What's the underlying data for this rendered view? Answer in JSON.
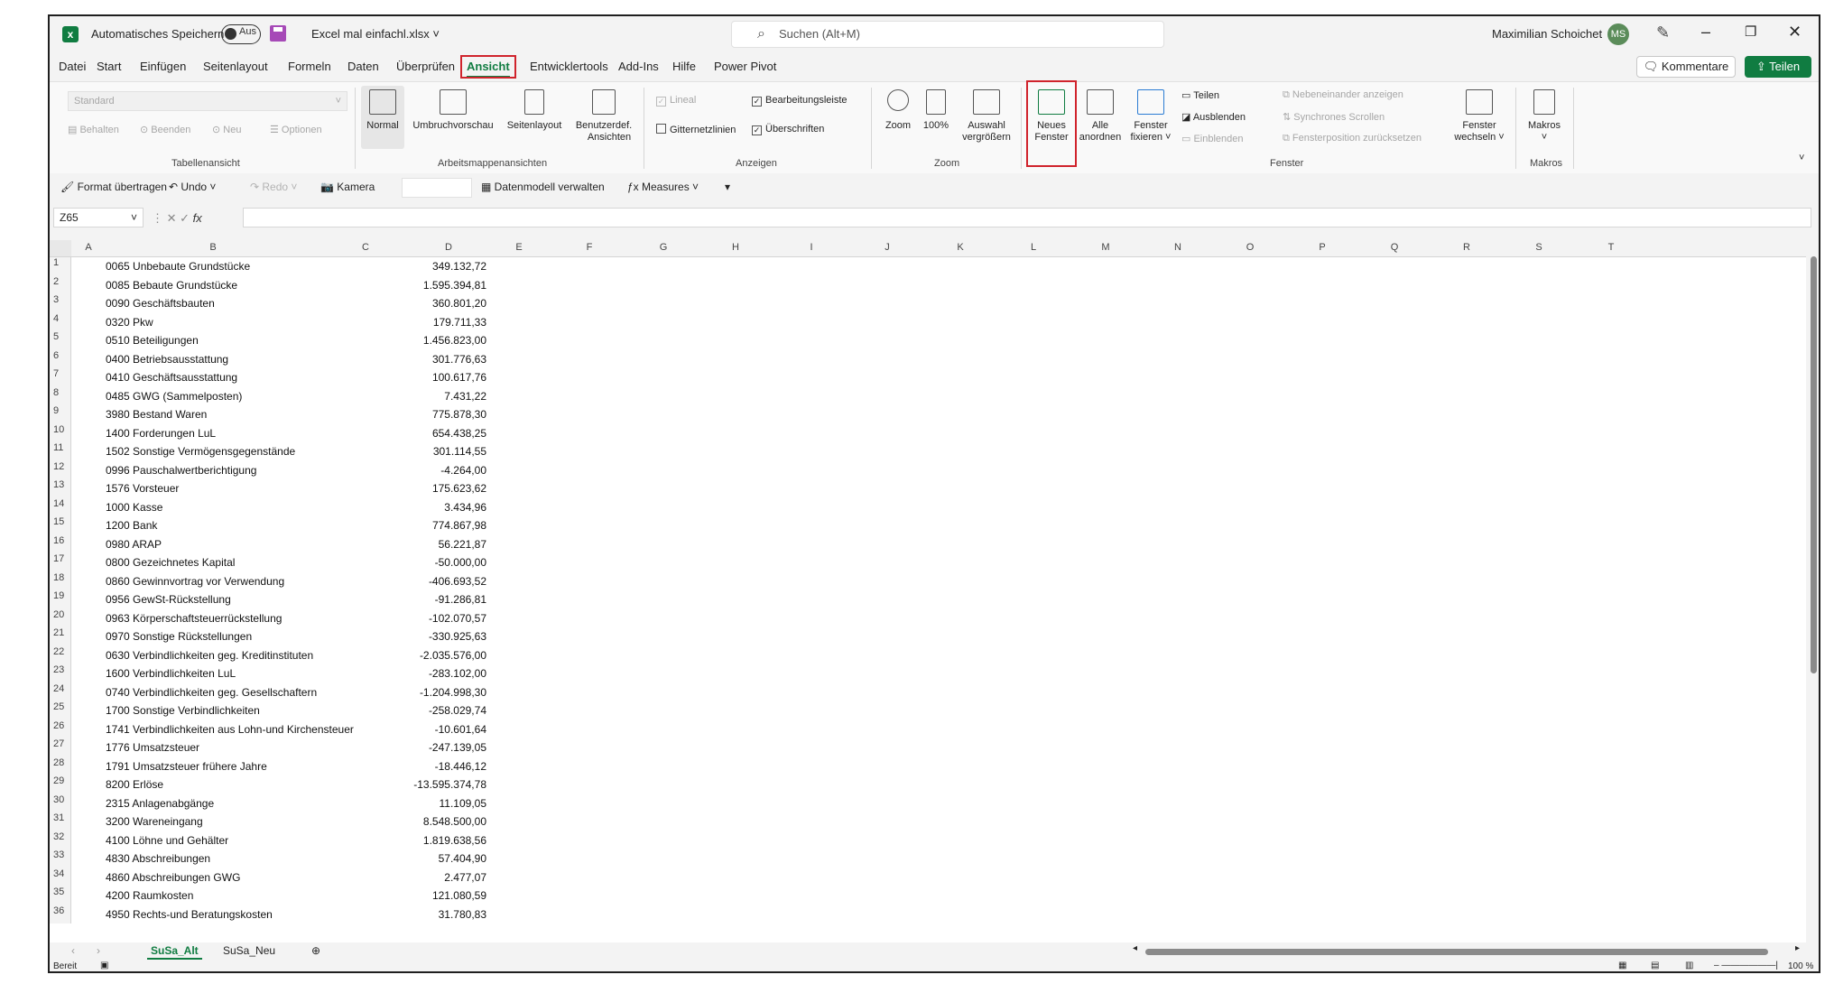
{
  "titlebar": {
    "autosave_label": "Automatisches Speichern",
    "toggle_state": "Aus",
    "filename": "Excel mal einfachl.xlsx",
    "search_placeholder": "Suchen (Alt+M)",
    "username": "Maximilian Schoichet",
    "avatar_initials": "MS"
  },
  "menu": {
    "tabs": [
      "Datei",
      "Start",
      "Einfügen",
      "Seitenlayout",
      "Formeln",
      "Daten",
      "Überprüfen",
      "Ansicht",
      "Entwicklertools",
      "Add-Ins",
      "Hilfe",
      "Power Pivot"
    ],
    "active_tab": "Ansicht",
    "kommentare": "Kommentare",
    "teilen": "Teilen"
  },
  "ribbon": {
    "sheetview": {
      "dropdown": "Standard",
      "behalten": "Behalten",
      "beenden": "Beenden",
      "neu": "Neu",
      "optionen": "Optionen",
      "label": "Tabellenansicht"
    },
    "workbook_views": {
      "normal": "Normal",
      "umbruch": "Umbruchvorschau",
      "seitenlayout": "Seitenlayout",
      "benutzerdef_1": "Benutzerdef.",
      "benutzerdef_2": "Ansichten",
      "label": "Arbeitsmappenansichten"
    },
    "show": {
      "lineal": "Lineal",
      "bearbeitungsleiste": "Bearbeitungsleiste",
      "gitternetzlinien": "Gitternetzlinien",
      "ueberschriften": "Überschriften",
      "label": "Anzeigen"
    },
    "zoom": {
      "zoom": "Zoom",
      "hundred": "100%",
      "auswahl_1": "Auswahl",
      "auswahl_2": "vergrößern",
      "label": "Zoom"
    },
    "window": {
      "neues_1": "Neues",
      "neues_2": "Fenster",
      "alle_1": "Alle",
      "alle_2": "anordnen",
      "fixieren_1": "Fenster",
      "fixieren_2": "fixieren ˅",
      "teilen": "Teilen",
      "ausblenden": "Ausblenden",
      "einblenden": "Einblenden",
      "nebeneinander": "Nebeneinander anzeigen",
      "synchron": "Synchrones Scrollen",
      "position": "Fensterposition zurücksetzen",
      "wechseln_1": "Fenster",
      "wechseln_2": "wechseln ˅",
      "label": "Fenster"
    },
    "macros": {
      "makros": "Makros",
      "label": "Makros"
    }
  },
  "qat": {
    "format": "Format übertragen",
    "undo": "Undo",
    "redo": "Redo",
    "kamera": "Kamera",
    "datenmodell": "Datenmodell verwalten",
    "measures": "Measures"
  },
  "formula_bar": {
    "name_box": "Z65",
    "fx": "fx"
  },
  "columns": [
    "A",
    "B",
    "C",
    "D",
    "E",
    "F",
    "G",
    "H",
    "I",
    "J",
    "K",
    "L",
    "M",
    "N",
    "O",
    "P",
    "Q",
    "R",
    "S",
    "T"
  ],
  "rows": [
    {
      "n": "1",
      "b": "0065 Unbebaute Grundstücke",
      "c": "349.132,72"
    },
    {
      "n": "2",
      "b": "0085 Bebaute Grundstücke",
      "c": "1.595.394,81"
    },
    {
      "n": "3",
      "b": "0090 Geschäftsbauten",
      "c": "360.801,20"
    },
    {
      "n": "4",
      "b": "0320 Pkw",
      "c": "179.711,33"
    },
    {
      "n": "5",
      "b": "0510 Beteiligungen",
      "c": "1.456.823,00"
    },
    {
      "n": "6",
      "b": "0400 Betriebsausstattung",
      "c": "301.776,63"
    },
    {
      "n": "7",
      "b": "0410 Geschäftsausstattung",
      "c": "100.617,76"
    },
    {
      "n": "8",
      "b": "0485 GWG (Sammelposten)",
      "c": "7.431,22"
    },
    {
      "n": "9",
      "b": "3980 Bestand Waren",
      "c": "775.878,30"
    },
    {
      "n": "10",
      "b": "1400 Forderungen LuL",
      "c": "654.438,25"
    },
    {
      "n": "11",
      "b": "1502 Sonstige Vermögensgegenstände",
      "c": "301.114,55"
    },
    {
      "n": "12",
      "b": "0996 Pauschalwertberichtigung",
      "c": "-4.264,00"
    },
    {
      "n": "13",
      "b": "1576 Vorsteuer",
      "c": "175.623,62"
    },
    {
      "n": "14",
      "b": "1000 Kasse",
      "c": "3.434,96"
    },
    {
      "n": "15",
      "b": "1200 Bank",
      "c": "774.867,98"
    },
    {
      "n": "16",
      "b": "0980 ARAP",
      "c": "56.221,87"
    },
    {
      "n": "17",
      "b": "0800 Gezeichnetes Kapital",
      "c": "-50.000,00"
    },
    {
      "n": "18",
      "b": "0860 Gewinnvortrag vor Verwendung",
      "c": "-406.693,52"
    },
    {
      "n": "19",
      "b": "0956 GewSt-Rückstellung",
      "c": "-91.286,81"
    },
    {
      "n": "20",
      "b": "0963 Körperschaftsteuerrückstellung",
      "c": "-102.070,57"
    },
    {
      "n": "21",
      "b": "0970 Sonstige Rückstellungen",
      "c": "-330.925,63"
    },
    {
      "n": "22",
      "b": "0630 Verbindlichkeiten geg. Kreditinstituten",
      "c": "-2.035.576,00"
    },
    {
      "n": "23",
      "b": "1600 Verbindlichkeiten LuL",
      "c": "-283.102,00"
    },
    {
      "n": "24",
      "b": "0740 Verbindlichkeiten geg. Gesellschaftern",
      "c": "-1.204.998,30"
    },
    {
      "n": "25",
      "b": "1700 Sonstige Verbindlichkeiten",
      "c": "-258.029,74"
    },
    {
      "n": "26",
      "b": "1741 Verbindlichkeiten aus Lohn-und Kirchensteuer",
      "c": "-10.601,64"
    },
    {
      "n": "27",
      "b": "1776 Umsatzsteuer",
      "c": "-247.139,05"
    },
    {
      "n": "28",
      "b": "1791 Umsatzsteuer frühere Jahre",
      "c": "-18.446,12"
    },
    {
      "n": "29",
      "b": "8200 Erlöse",
      "c": "-13.595.374,78"
    },
    {
      "n": "30",
      "b": "2315 Anlagenabgänge",
      "c": "11.109,05"
    },
    {
      "n": "31",
      "b": "3200 Wareneingang",
      "c": "8.548.500,00"
    },
    {
      "n": "32",
      "b": "4100 Löhne und Gehälter",
      "c": "1.819.638,56"
    },
    {
      "n": "33",
      "b": "4830 Abschreibungen",
      "c": "57.404,90"
    },
    {
      "n": "34",
      "b": "4860 Abschreibungen GWG",
      "c": "2.477,07"
    },
    {
      "n": "35",
      "b": "4200 Raumkosten",
      "c": "121.080,59"
    },
    {
      "n": "36",
      "b": "4950 Rechts-und Beratungskosten",
      "c": "31.780,83"
    }
  ],
  "sheets": [
    "SuSa_Alt",
    "SuSa_Neu"
  ],
  "active_sheet": "SuSa_Alt",
  "status": {
    "ready": "Bereit",
    "zoom": "100 %"
  },
  "colors": {
    "accent": "#107c41",
    "highlight": "#d0232c"
  }
}
